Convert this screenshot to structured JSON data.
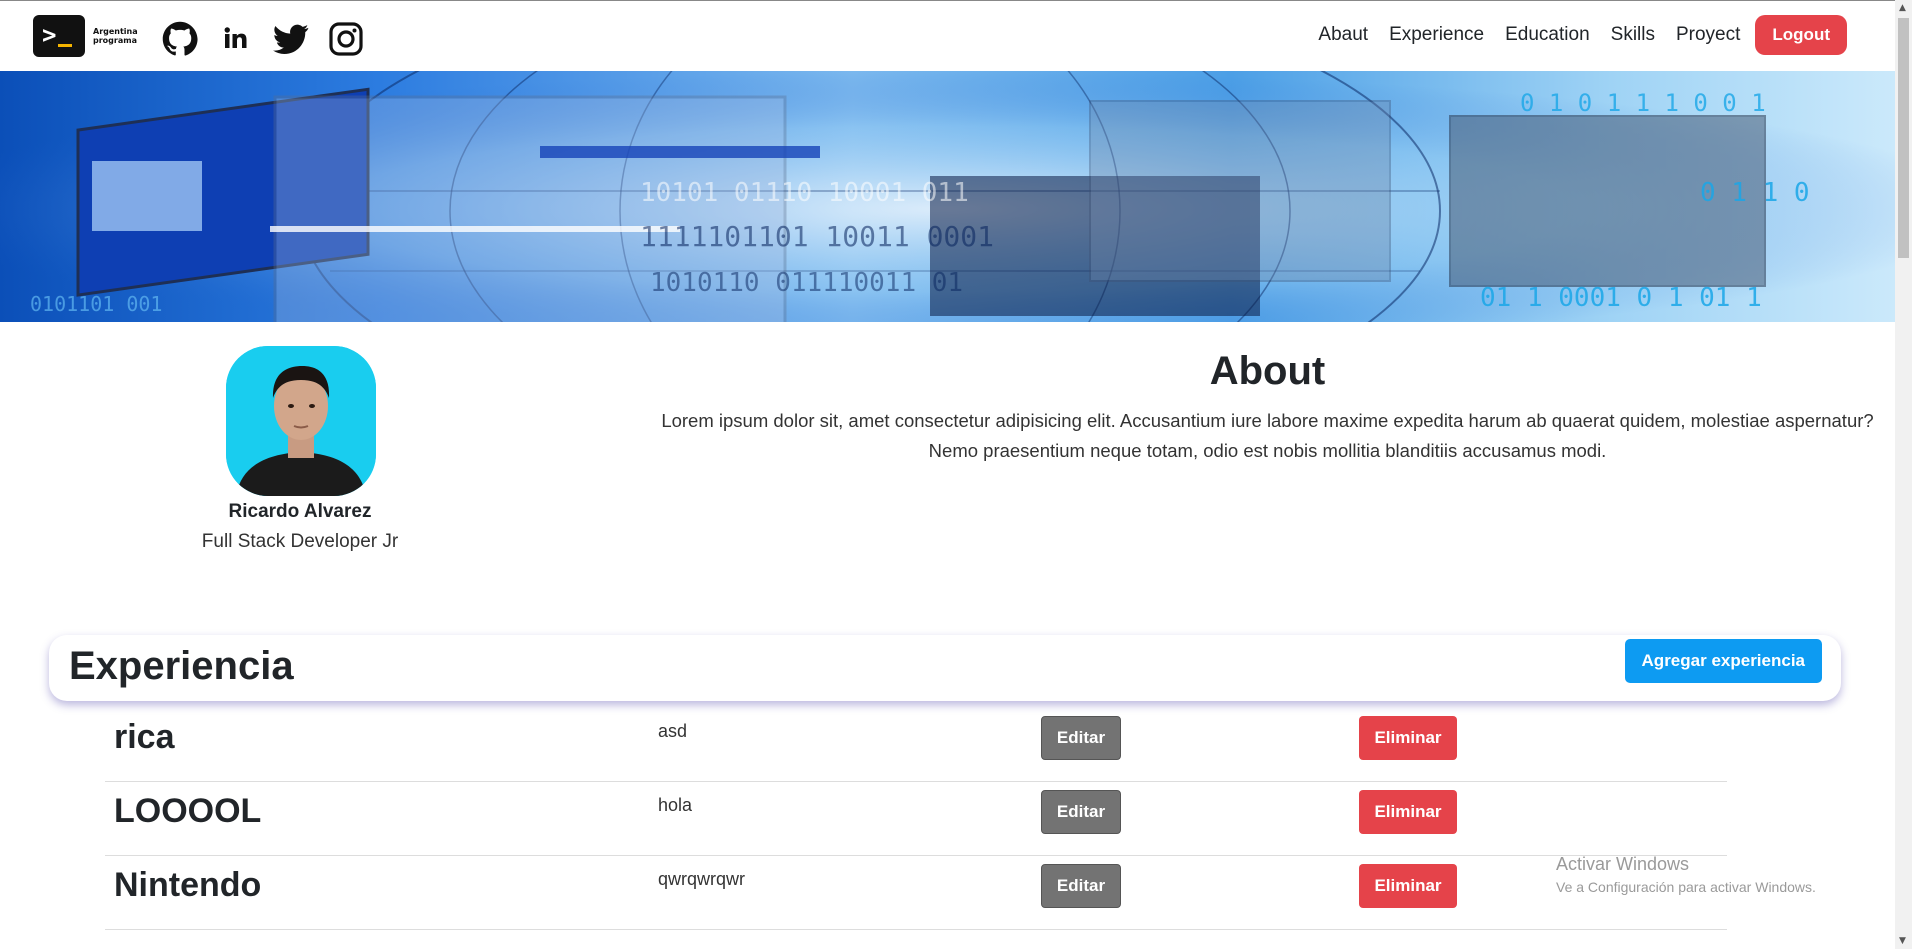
{
  "nav": {
    "brand_line1": "Argentina",
    "brand_line2": "programa",
    "social": [
      "github-icon",
      "linkedin-icon",
      "twitter-icon",
      "instagram-icon"
    ],
    "links": [
      "Abaut",
      "Experience",
      "Education",
      "Skills",
      "Proyect"
    ],
    "logout": "Logout"
  },
  "profile": {
    "name": "Ricardo Alvarez",
    "title": "Full Stack Developer Jr"
  },
  "about": {
    "heading": "About",
    "text": "Lorem ipsum dolor sit, amet consectetur adipisicing elit. Accusantium iure labore maxime expedita harum ab quaerat quidem, molestiae aspernatur? Nemo praesentium neque totam, odio est nobis mollitia blanditiis accusamus modi."
  },
  "experience": {
    "heading": "Experiencia",
    "add_label": "Agregar experiencia",
    "edit_label": "Editar",
    "delete_label": "Eliminar",
    "items": [
      {
        "name": "rica",
        "desc": "asd"
      },
      {
        "name": "LOOOOL",
        "desc": "hola"
      },
      {
        "name": "Nintendo",
        "desc": "qwrqwrqwr"
      }
    ]
  },
  "watermark": {
    "line1": "Activar Windows",
    "line2": "Ve a Configuración para activar Windows."
  },
  "colors": {
    "danger": "#e5434a",
    "primary": "#0d9bf2",
    "secondary": "#737373"
  }
}
